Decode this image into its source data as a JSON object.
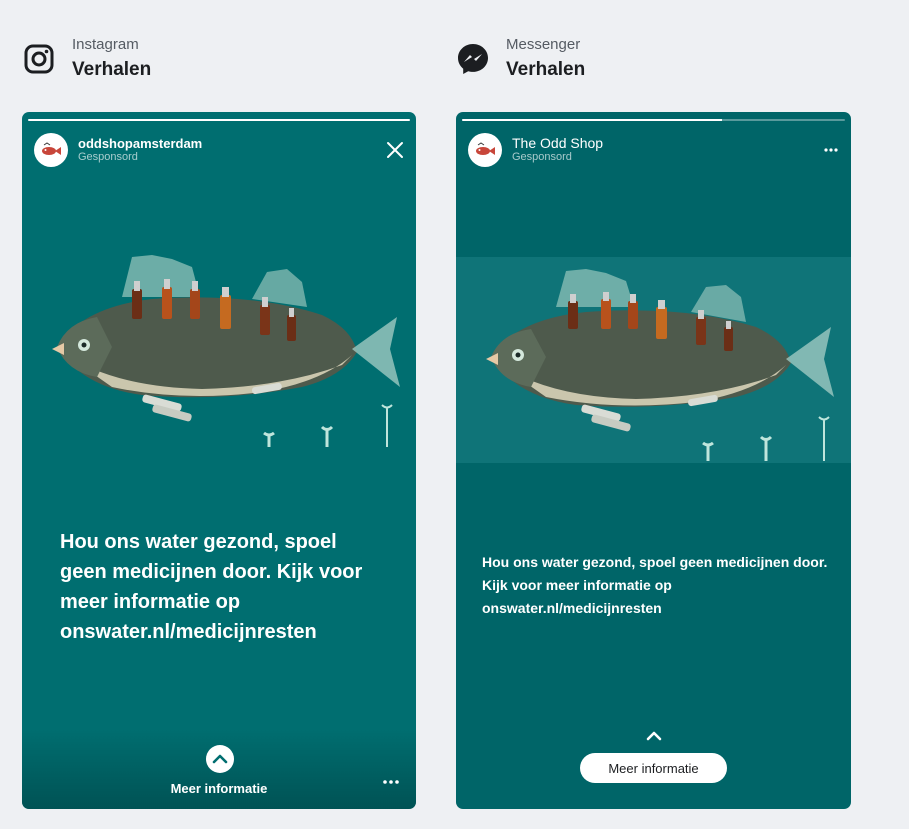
{
  "instagram": {
    "platform": "Instagram",
    "placement": "Verhalen",
    "icon": "instagram-icon",
    "story": {
      "account_name": "oddshopamsterdam",
      "sponsored": "Gesponsord",
      "progress": 1.0,
      "caption": "Hou ons water gezond, spoel geen medicijnen door. Kijk voor meer informatie op onswater.nl/medicijnresten",
      "cta_label": "Meer informatie",
      "close_icon": "close-icon",
      "more_icon": "more-dots-icon"
    }
  },
  "messenger": {
    "platform": "Messenger",
    "placement": "Verhalen",
    "icon": "messenger-icon",
    "story": {
      "account_name": "The Odd Shop",
      "sponsored": "Gesponsord",
      "progress": 0.68,
      "caption": "Hou ons water gezond, spoel geen medicijnen door. Kijk voor meer informatie op onswater.nl/medicijnresten",
      "cta_label": "Meer informatie",
      "more_icon": "more-dots-icon"
    }
  },
  "colors": {
    "page_bg": "#eef0f3",
    "story_teal": "#006e70",
    "fish_band": "#0f7478"
  }
}
